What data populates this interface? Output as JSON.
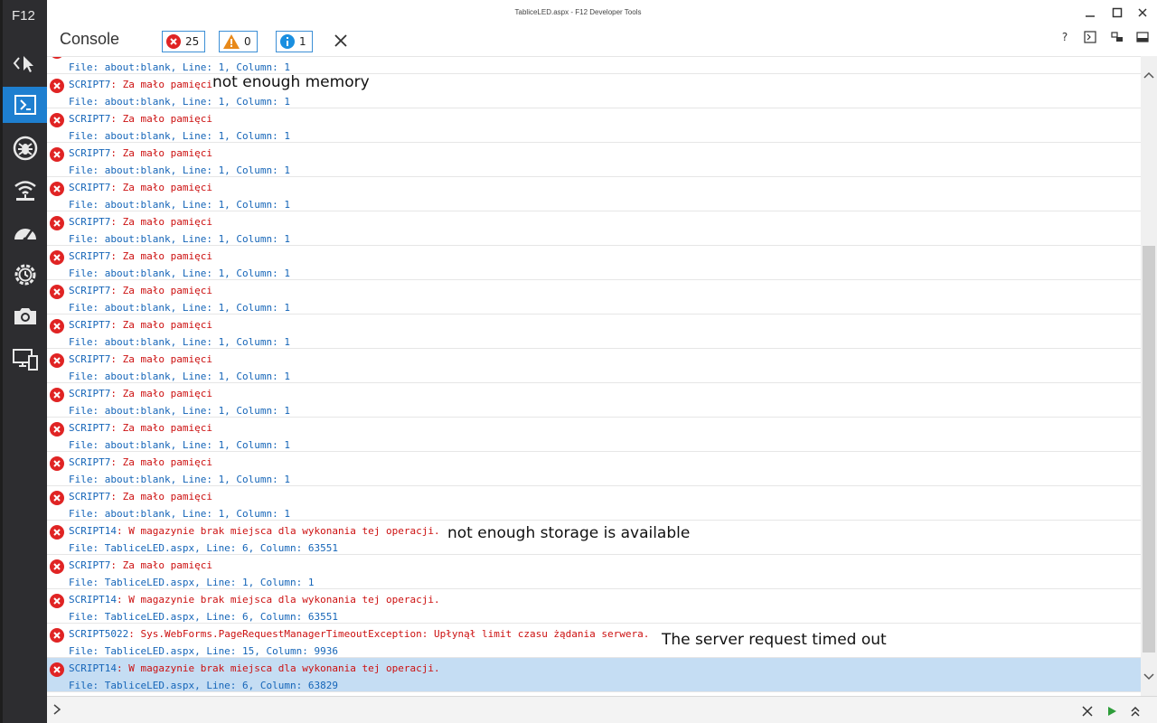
{
  "app": {
    "name": "F12",
    "window_title": "TabliceLED.aspx - F12 Developer Tools"
  },
  "tools": [
    {
      "name": "dom-explorer",
      "icon": "cursor-select-icon",
      "active": false
    },
    {
      "name": "console",
      "icon": "console-icon",
      "active": true
    },
    {
      "name": "debugger",
      "icon": "bug-icon",
      "active": false
    },
    {
      "name": "network",
      "icon": "wifi-icon",
      "active": false
    },
    {
      "name": "performance",
      "icon": "gauge-icon",
      "active": false
    },
    {
      "name": "memory",
      "icon": "clock-gear-icon",
      "active": false
    },
    {
      "name": "screenshot",
      "icon": "camera-icon",
      "active": false
    },
    {
      "name": "emulation",
      "icon": "devices-icon",
      "active": false
    }
  ],
  "header": {
    "title": "Console",
    "errors": "25",
    "warnings": "0",
    "info": "1",
    "help": "?"
  },
  "partial_entry": {
    "loc": "File: about:blank, Line: 1, Column: 1"
  },
  "entries": [
    {
      "code": "SCRIPT7",
      "text": ": Za mało pamięci",
      "loc": "File: about:blank, Line: 1, Column: 1"
    },
    {
      "code": "SCRIPT7",
      "text": ": Za mało pamięci",
      "loc": "File: about:blank, Line: 1, Column: 1"
    },
    {
      "code": "SCRIPT7",
      "text": ": Za mało pamięci",
      "loc": "File: about:blank, Line: 1, Column: 1"
    },
    {
      "code": "SCRIPT7",
      "text": ": Za mało pamięci",
      "loc": "File: about:blank, Line: 1, Column: 1"
    },
    {
      "code": "SCRIPT7",
      "text": ": Za mało pamięci",
      "loc": "File: about:blank, Line: 1, Column: 1"
    },
    {
      "code": "SCRIPT7",
      "text": ": Za mało pamięci",
      "loc": "File: about:blank, Line: 1, Column: 1"
    },
    {
      "code": "SCRIPT7",
      "text": ": Za mało pamięci",
      "loc": "File: about:blank, Line: 1, Column: 1"
    },
    {
      "code": "SCRIPT7",
      "text": ": Za mało pamięci",
      "loc": "File: about:blank, Line: 1, Column: 1"
    },
    {
      "code": "SCRIPT7",
      "text": ": Za mało pamięci",
      "loc": "File: about:blank, Line: 1, Column: 1"
    },
    {
      "code": "SCRIPT7",
      "text": ": Za mało pamięci",
      "loc": "File: about:blank, Line: 1, Column: 1"
    },
    {
      "code": "SCRIPT7",
      "text": ": Za mało pamięci",
      "loc": "File: about:blank, Line: 1, Column: 1"
    },
    {
      "code": "SCRIPT7",
      "text": ": Za mało pamięci",
      "loc": "File: about:blank, Line: 1, Column: 1"
    },
    {
      "code": "SCRIPT7",
      "text": ": Za mało pamięci",
      "loc": "File: about:blank, Line: 1, Column: 1"
    },
    {
      "code": "SCRIPT14",
      "text": ": W magazynie brak miejsca dla wykonania tej operacji.",
      "loc": "File: TabliceLED.aspx, Line: 6, Column: 63551"
    },
    {
      "code": "SCRIPT7",
      "text": ": Za mało pamięci",
      "loc": "File: TabliceLED.aspx, Line: 1, Column: 1"
    },
    {
      "code": "SCRIPT14",
      "text": ": W magazynie brak miejsca dla wykonania tej operacji.",
      "loc": "File: TabliceLED.aspx, Line: 6, Column: 63551"
    },
    {
      "code": "SCRIPT5022",
      "text": ": Sys.WebForms.PageRequestManagerTimeoutException: Upłynął limit czasu żądania serwera.",
      "loc": "File: TabliceLED.aspx, Line: 15, Column: 9936"
    },
    {
      "code": "SCRIPT14",
      "text": ": W magazynie brak miejsca dla wykonania tej operacji.",
      "loc": "File: TabliceLED.aspx, Line: 6, Column: 63829",
      "selected": true
    }
  ],
  "annotations": {
    "memory": "not enough memory",
    "storage": "not enough storage is available",
    "timeout": "The server request timed out"
  },
  "input": {
    "prompt": ">"
  },
  "colors": {
    "accent": "#1e7fd0",
    "error": "#e02424",
    "warning": "#e8891a",
    "info": "#1a8fe0",
    "selected_row": "#c5ddf3"
  }
}
